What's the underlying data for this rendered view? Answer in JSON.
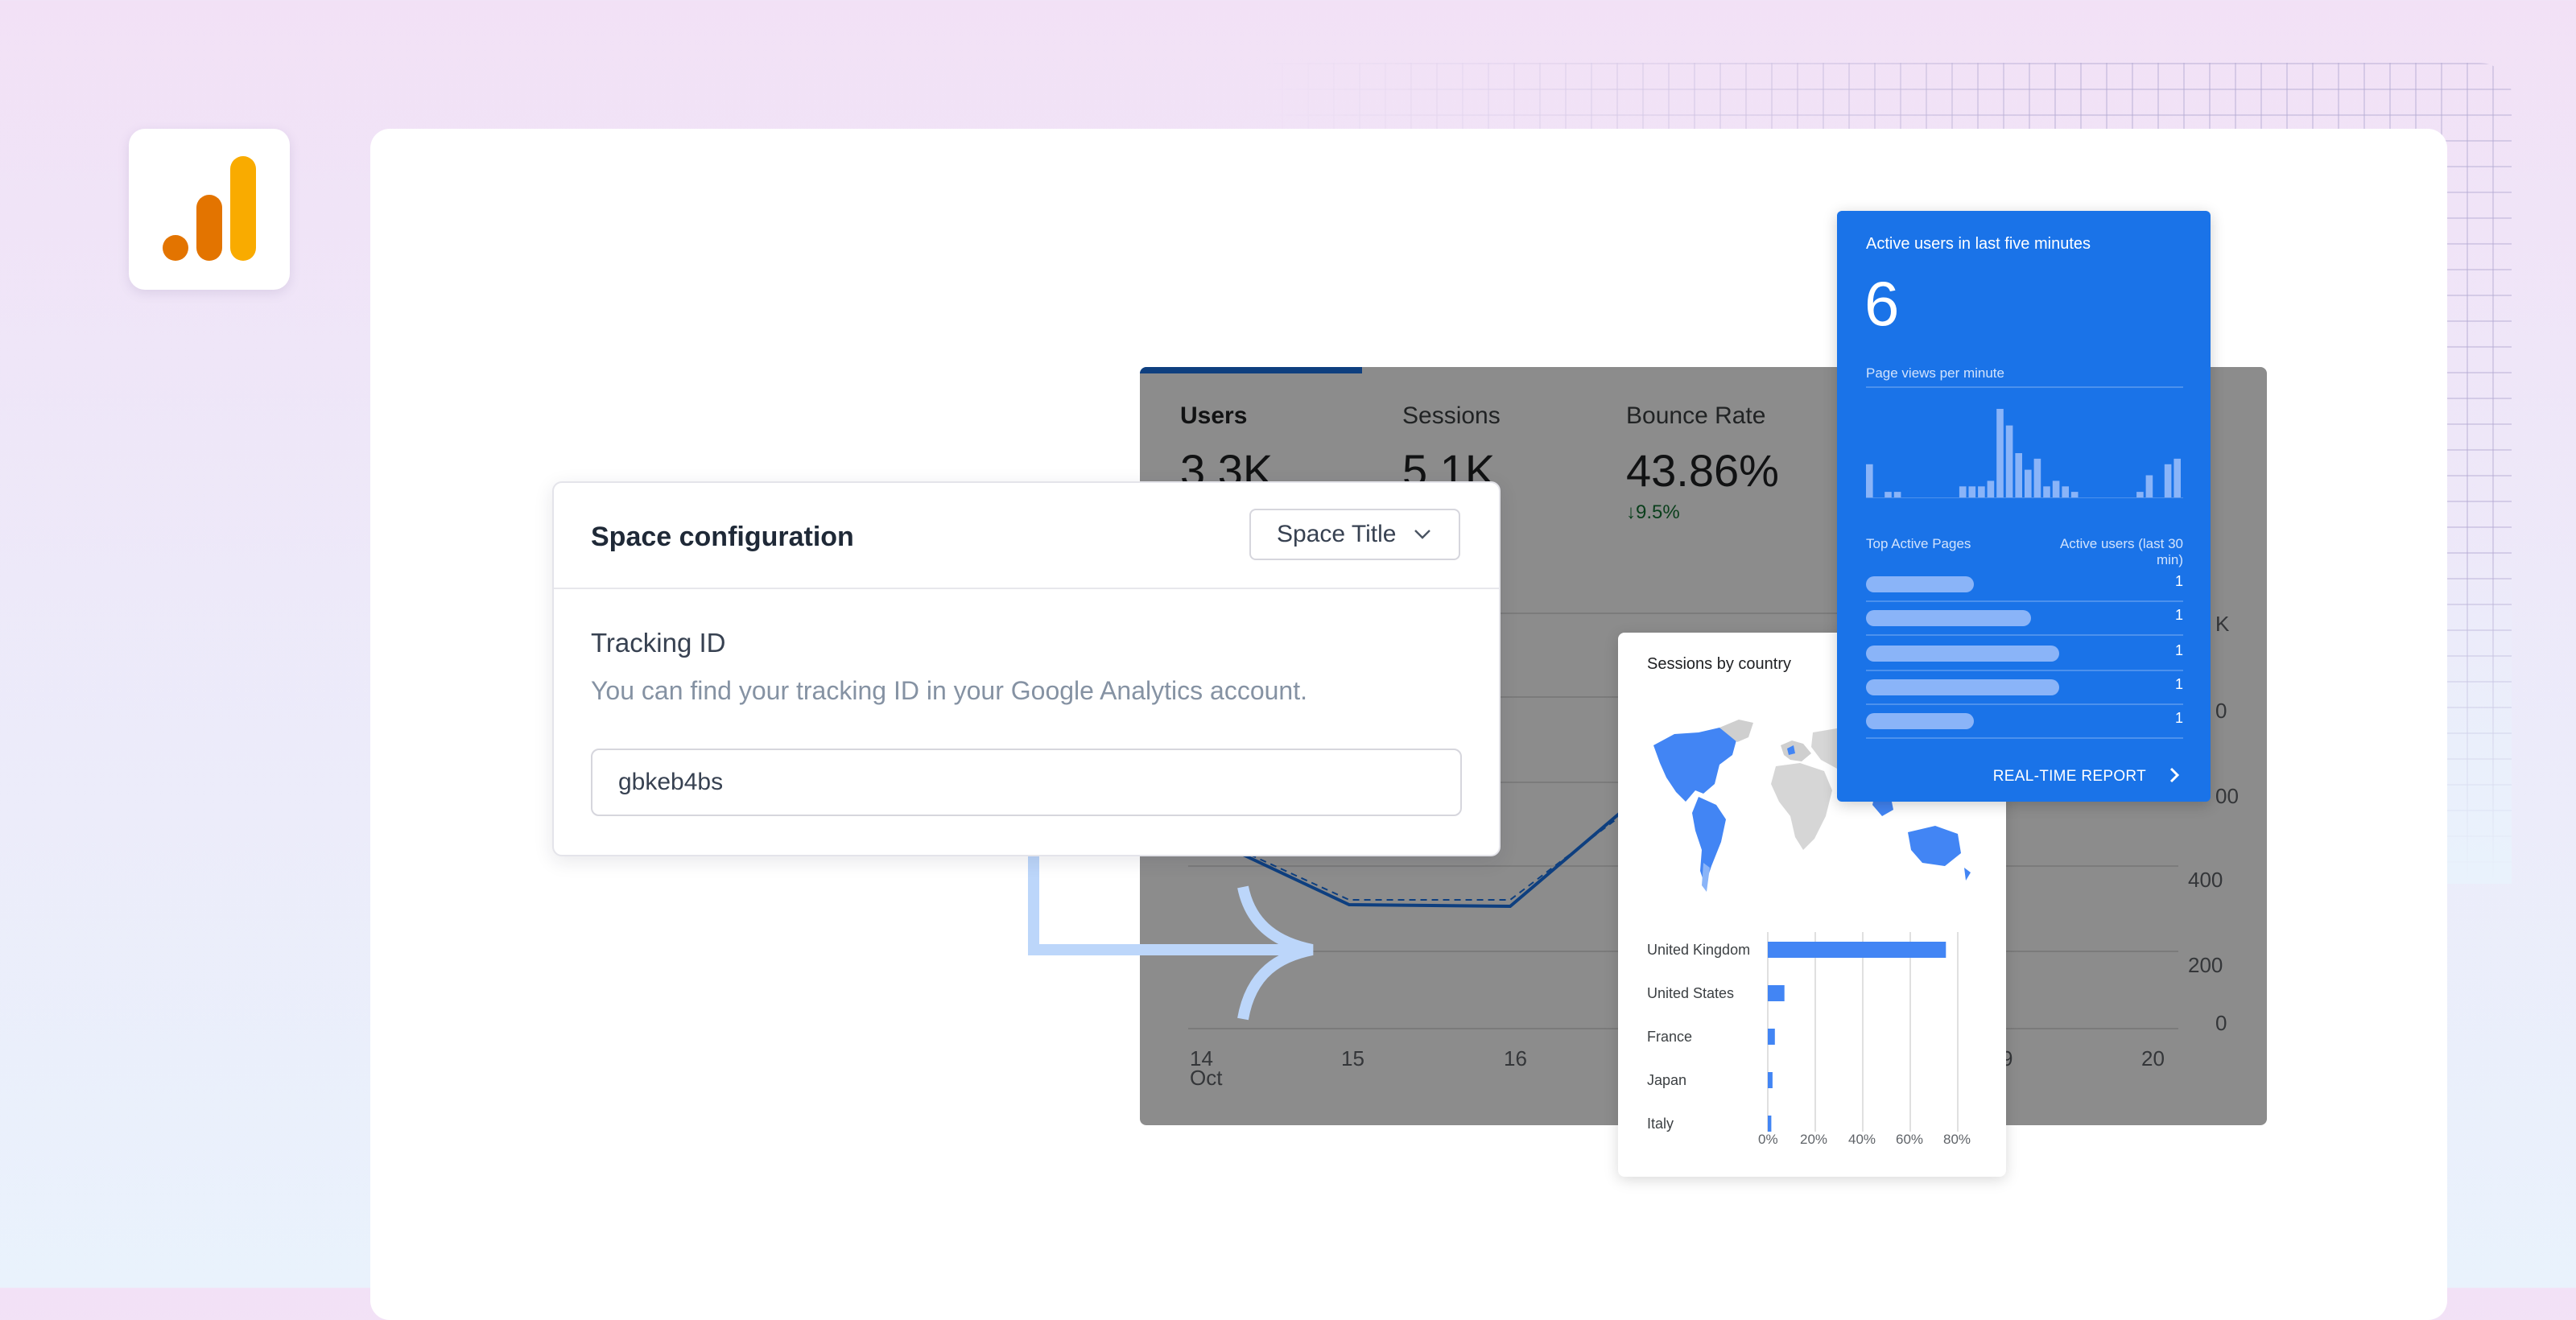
{
  "config": {
    "title": "Space configuration",
    "select_value": "Space Title",
    "field_label": "Tracking ID",
    "field_hint": "You can find your tracking ID in your Google Analytics account.",
    "tracking_id_value": "gbkeb4bs"
  },
  "overview": {
    "metrics": [
      {
        "label": "Users",
        "value": "3.3K",
        "change": ""
      },
      {
        "label": "Sessions",
        "value": "5.1K",
        "change": ""
      },
      {
        "label": "Bounce Rate",
        "value": "43.86%",
        "change": "9.5%"
      }
    ],
    "y_ticks": [
      "K",
      "0",
      "00",
      "400",
      "200",
      "0"
    ],
    "x_ticks": [
      "14",
      "15",
      "16",
      "9",
      "20"
    ],
    "x_month": "Oct"
  },
  "sessions_by_country": {
    "title": "Sessions by country",
    "rows": [
      {
        "country": "United Kingdom",
        "share": 0.75
      },
      {
        "country": "United States",
        "share": 0.07
      },
      {
        "country": "France",
        "share": 0.03
      },
      {
        "country": "Japan",
        "share": 0.02
      },
      {
        "country": "Italy",
        "share": 0.015
      }
    ],
    "axis_ticks": [
      "0%",
      "20%",
      "40%",
      "60%",
      "80%"
    ],
    "axis_max": 0.8
  },
  "realtime": {
    "title": "Active users in last five minutes",
    "active_users": "6",
    "subtitle": "Page views per minute",
    "histogram": [
      6,
      0,
      1,
      1,
      0,
      0,
      0,
      0,
      0,
      0,
      2,
      2,
      2,
      3,
      16,
      13,
      8,
      5,
      7,
      2,
      3,
      2,
      1,
      0,
      0,
      0,
      0,
      0,
      0,
      1,
      4,
      0,
      6,
      7
    ],
    "col_left": "Top Active Pages",
    "col_right": "Active users (last 30 min)",
    "pages": [
      {
        "fill": 0.34,
        "value": "1"
      },
      {
        "fill": 0.52,
        "value": "1"
      },
      {
        "fill": 0.61,
        "value": "1"
      },
      {
        "fill": 0.61,
        "value": "1"
      },
      {
        "fill": 0.34,
        "value": "1"
      }
    ],
    "link_label": "REAL-TIME REPORT"
  },
  "colors": {
    "brand_blue": "#1a73e8",
    "logo_orange_dark": "#e37400",
    "logo_orange": "#f9ab00"
  }
}
